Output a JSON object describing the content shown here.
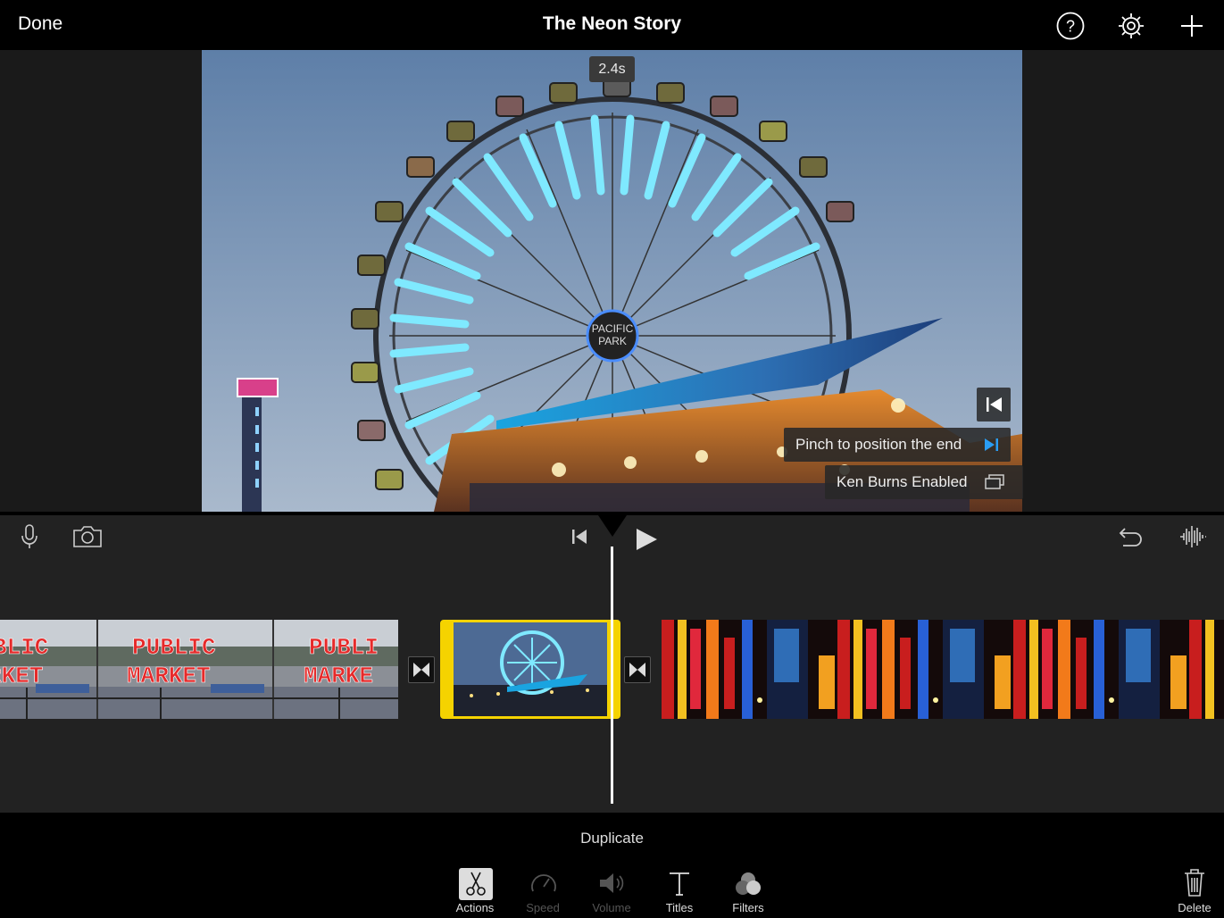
{
  "topbar": {
    "done_label": "Done",
    "title": "The Neon Story",
    "icons": [
      "help-icon",
      "settings-gear-icon",
      "add-plus-icon"
    ]
  },
  "preview": {
    "duration": "2.4s",
    "pinch_hint": "Pinch to position the end",
    "ken_burns_label": "Ken Burns Enabled"
  },
  "timeline": {
    "left_icons": [
      "microphone-icon",
      "camera-icon"
    ],
    "center_icons": [
      "skip-to-start-icon",
      "play-icon"
    ],
    "right_icons": [
      "undo-icon",
      "audio-waveform-icon"
    ],
    "clips": [
      "Public Market clip",
      "Ferris wheel clip (selected)",
      "Neon signs clip"
    ]
  },
  "actions": {
    "duplicate_label": "Duplicate",
    "tools": [
      {
        "label": "Actions",
        "icon": "scissors-icon",
        "active": true
      },
      {
        "label": "Speed",
        "icon": "speedometer-icon",
        "active": false
      },
      {
        "label": "Volume",
        "icon": "speaker-icon",
        "active": false
      },
      {
        "label": "Titles",
        "icon": "text-t-icon",
        "active": true
      },
      {
        "label": "Filters",
        "icon": "filters-circles-icon",
        "active": true
      }
    ],
    "delete_label": "Delete"
  },
  "colors": {
    "selection": "#f5d300",
    "accent_blue": "#2a9df4"
  }
}
